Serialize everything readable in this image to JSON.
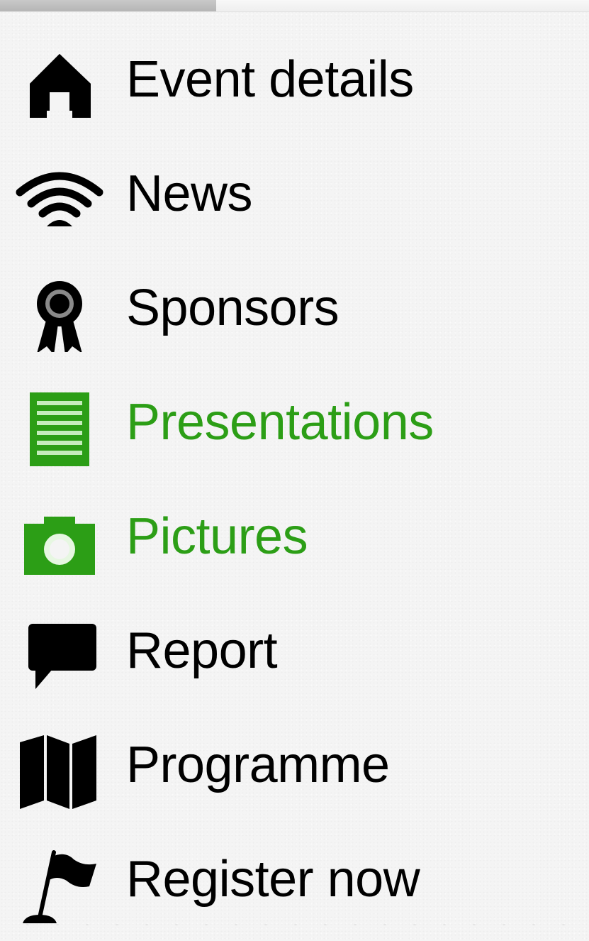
{
  "nav": {
    "items": [
      {
        "label": "Event details",
        "icon": "home-icon",
        "highlighted": false
      },
      {
        "label": "News",
        "icon": "wifi-icon",
        "highlighted": false
      },
      {
        "label": "Sponsors",
        "icon": "award-ribbon-icon",
        "highlighted": false
      },
      {
        "label": "Presentations",
        "icon": "document-list-icon",
        "highlighted": true
      },
      {
        "label": "Pictures",
        "icon": "camera-icon",
        "highlighted": true
      },
      {
        "label": "Report",
        "icon": "speech-bubble-icon",
        "highlighted": false
      },
      {
        "label": "Programme",
        "icon": "map-icon",
        "highlighted": false
      },
      {
        "label": "Register now",
        "icon": "flag-icon",
        "highlighted": false
      }
    ]
  },
  "colors": {
    "text": "#000000",
    "highlight": "#2c9e16",
    "background": "#f4f4f4"
  }
}
